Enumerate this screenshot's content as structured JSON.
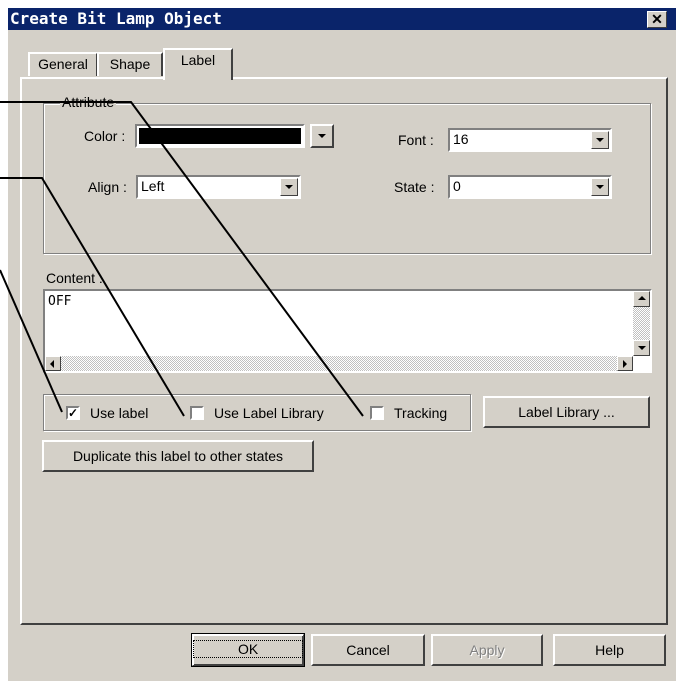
{
  "window": {
    "title": "Create Bit Lamp  Object",
    "close": "✕"
  },
  "tabs": [
    {
      "label": "General"
    },
    {
      "label": "Shape"
    },
    {
      "label": "Label",
      "active": true
    }
  ],
  "attribute": {
    "group_label": "Attribute",
    "color_label": "Color :",
    "color_value": "#000000",
    "align_label": "Align :",
    "align_value": "Left",
    "font_label": "Font :",
    "font_value": "16",
    "state_label": "State :",
    "state_value": "0"
  },
  "content": {
    "label": "Content :",
    "text": "OFF"
  },
  "options": {
    "use_label": {
      "label": "Use label",
      "checked": true
    },
    "use_label_library": {
      "label": "Use Label Library",
      "checked": false
    },
    "tracking": {
      "label": "Tracking",
      "checked": false
    },
    "label_library_button": "Label Library ...",
    "duplicate_button": "Duplicate this label to other states"
  },
  "buttons": {
    "ok": "OK",
    "cancel": "Cancel",
    "apply": "Apply",
    "help": "Help"
  },
  "colors": {
    "titlebar": "#0a246a",
    "face": "#d4d0c8"
  },
  "icons": {
    "dropdown": "dropdown-arrow-icon",
    "check": "checkmark-icon"
  }
}
